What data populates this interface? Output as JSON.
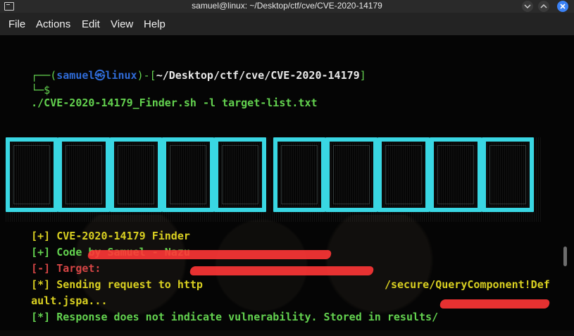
{
  "window": {
    "title": "samuel@linux: ~/Desktop/ctf/cve/CVE-2020-14179",
    "menu": [
      "File",
      "Actions",
      "Edit",
      "View",
      "Help"
    ]
  },
  "terminal": {
    "prompt": {
      "prefix": "┌──(",
      "user_host": "samuel㉿linux",
      "middle": ")-[",
      "path": "~/Desktop/ctf/cve/CVE-2020-14179",
      "suffix": "]",
      "second_prefix": "└─$",
      "command": "./CVE-2020-14179_Finder.sh -l target-list.txt"
    },
    "output_lines": [
      {
        "tag": "[+]",
        "text": "CVE-2020-14179 Finder",
        "color": "yellow"
      },
      {
        "tag": "[+]",
        "text": "Code by Samuel - Nazu",
        "color": "green"
      },
      {
        "tag": "[-]",
        "text": "Target:",
        "color": "red"
      },
      {
        "tag": "[*]",
        "text": "Sending request to http",
        "color": "yellow",
        "tail": "/secure/QueryComponent!Def"
      },
      {
        "tag": "",
        "text": "ault.jspa...",
        "color": "yellow"
      },
      {
        "tag": "[*]",
        "text": "Response does not indicate vulnerability. Stored in results/",
        "color": "green"
      }
    ]
  },
  "colors": {
    "blue": "#2f6bd6",
    "green": "#63d24f",
    "cyan": "#39d7e3",
    "yellow": "#d9d021",
    "red": "#d64545",
    "terminal_bg": "#050505",
    "close_button": "#3b82f6"
  },
  "icons": {
    "terminal": "terminal-window-icon",
    "minimize": "chevron-down-icon",
    "maximize": "chevron-up-icon",
    "close": "close-icon"
  }
}
